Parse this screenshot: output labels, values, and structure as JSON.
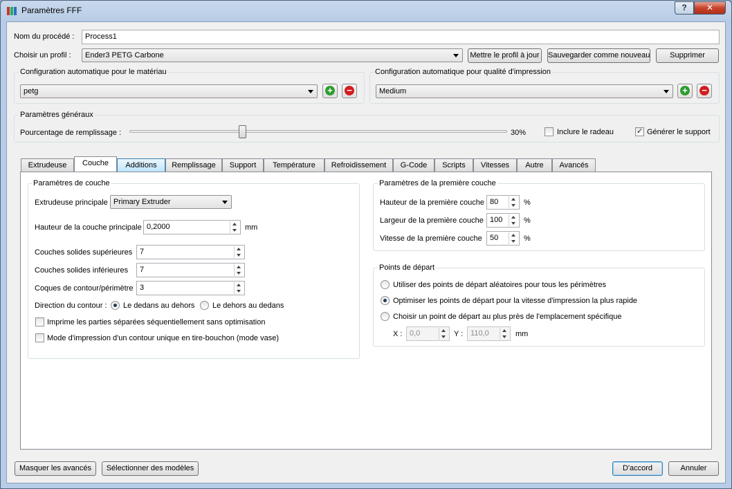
{
  "window": {
    "title": "Paramètres FFF",
    "help": "?",
    "close": "✕"
  },
  "process": {
    "label": "Nom du procédé :",
    "value": "Process1"
  },
  "profile": {
    "label": "Choisir un profil :",
    "selected": "Ender3 PETG Carbone",
    "update_button": "Mettre le profil à jour",
    "save_new_button": "Sauvegarder comme nouveau",
    "delete_button": "Supprimer"
  },
  "material_config": {
    "title": "Configuration automatique pour le matériau",
    "selected": "petg"
  },
  "quality_config": {
    "title": "Configuration automatique pour qualité d'impression",
    "selected": "Medium"
  },
  "general": {
    "title": "Paramètres généraux",
    "infill_label": "Pourcentage de remplissage :",
    "infill_value": "30%",
    "infill_fraction": 0.3,
    "raft_label": "Inclure le radeau",
    "raft_checked": false,
    "support_label": "Générer le support",
    "support_checked": true,
    "check_mark": "✓"
  },
  "tabs": [
    {
      "label": "Extrudeuse"
    },
    {
      "label": "Couche"
    },
    {
      "label": "Additions"
    },
    {
      "label": "Remplissage"
    },
    {
      "label": "Support"
    },
    {
      "label": "Température"
    },
    {
      "label": "Refroidissement"
    },
    {
      "label": "G-Code"
    },
    {
      "label": "Scripts"
    },
    {
      "label": "Vitesses"
    },
    {
      "label": "Autre"
    },
    {
      "label": "Avancés"
    }
  ],
  "layer": {
    "title": "Paramètres de couche",
    "main_extruder_label": "Extrudeuse principale",
    "main_extruder_value": "Primary Extruder",
    "layer_height_label": "Hauteur de la couche principale",
    "layer_height_value": "0,2000",
    "layer_height_unit": "mm",
    "top_solid_label": "Couches solides supérieures",
    "top_solid_value": "7",
    "bottom_solid_label": "Couches solides inférieures",
    "bottom_solid_value": "7",
    "perimeters_label": "Coques de contour/périmètre",
    "perimeters_value": "3",
    "direction_label": "Direction du contour :",
    "direction_inside_out": "Le dedans au dehors",
    "direction_outside_in": "Le dehors au dedans",
    "sequential_label": "Imprime les parties séparées séquentiellement sans optimisation",
    "vase_label": "Mode d'impression d'un contour unique en tire-bouchon (mode vase)"
  },
  "first_layer": {
    "title": "Paramètres de la première couche",
    "height_label": "Hauteur de la première couche",
    "height_value": "80",
    "width_label": "Largeur de la première couche",
    "width_value": "100",
    "speed_label": "Vitesse de la première couche",
    "speed_value": "50",
    "unit": "%"
  },
  "start_points": {
    "title": "Points de départ",
    "random_label": "Utiliser des points de départ aléatoires pour tous les périmètres",
    "optimize_label": "Optimiser les points de départ pour la vitesse d'impression la plus rapide",
    "specific_label": "Choisir un point de départ au plus près de l'emplacement spécifique",
    "x_label": "X :",
    "x_value": "0,0",
    "y_label": "Y :",
    "y_value": "110,0",
    "unit": "mm"
  },
  "footer": {
    "hide_advanced_button": "Masquer les avancés",
    "select_models_button": "Sélectionner des modèles",
    "ok_button": "D'accord",
    "cancel_button": "Annuler"
  }
}
